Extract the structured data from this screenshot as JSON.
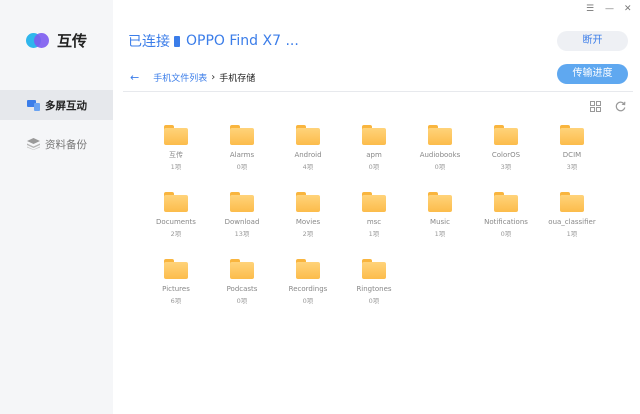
{
  "app": {
    "name": "互传"
  },
  "window": {
    "menu_glyph": "☰",
    "minimize_glyph": "—",
    "close_glyph": "✕"
  },
  "sidebar": {
    "items": [
      {
        "label": "多屏互动",
        "icon": "screens-icon",
        "active": true
      },
      {
        "label": "资料备份",
        "icon": "layers-icon",
        "active": false
      }
    ]
  },
  "header": {
    "title": "已连接",
    "device": "OPPO Find X7 ...",
    "disconnect_label": "断开",
    "progress_label": "传输进度"
  },
  "breadcrumb": {
    "back_glyph": "←",
    "parent": "手机文件列表",
    "separator": "›",
    "current": "手机存储"
  },
  "toolbar": {
    "grid_view_icon": "grid-view-icon",
    "refresh_icon": "refresh-icon"
  },
  "folders": [
    {
      "name": "互传",
      "count": "1项"
    },
    {
      "name": "Alarms",
      "count": "0项"
    },
    {
      "name": "Android",
      "count": "4项"
    },
    {
      "name": "apm",
      "count": "0项"
    },
    {
      "name": "Audiobooks",
      "count": "0项"
    },
    {
      "name": "ColorOS",
      "count": "3项"
    },
    {
      "name": "DCIM",
      "count": "3项"
    },
    {
      "name": "Documents",
      "count": "2项"
    },
    {
      "name": "Download",
      "count": "13项"
    },
    {
      "name": "Movies",
      "count": "2项"
    },
    {
      "name": "msc",
      "count": "1项"
    },
    {
      "name": "Music",
      "count": "1项"
    },
    {
      "name": "Notifications",
      "count": "0项"
    },
    {
      "name": "oua_classifier",
      "count": "1项"
    },
    {
      "name": "Pictures",
      "count": "6项"
    },
    {
      "name": "Podcasts",
      "count": "0项"
    },
    {
      "name": "Recordings",
      "count": "0项"
    },
    {
      "name": "Ringtones",
      "count": "0项"
    }
  ],
  "colors": {
    "accent": "#3b7de9",
    "folder": "#fcbc4b",
    "sidebar_bg": "#f5f6f8",
    "progress_button": "#5fa8f0"
  }
}
